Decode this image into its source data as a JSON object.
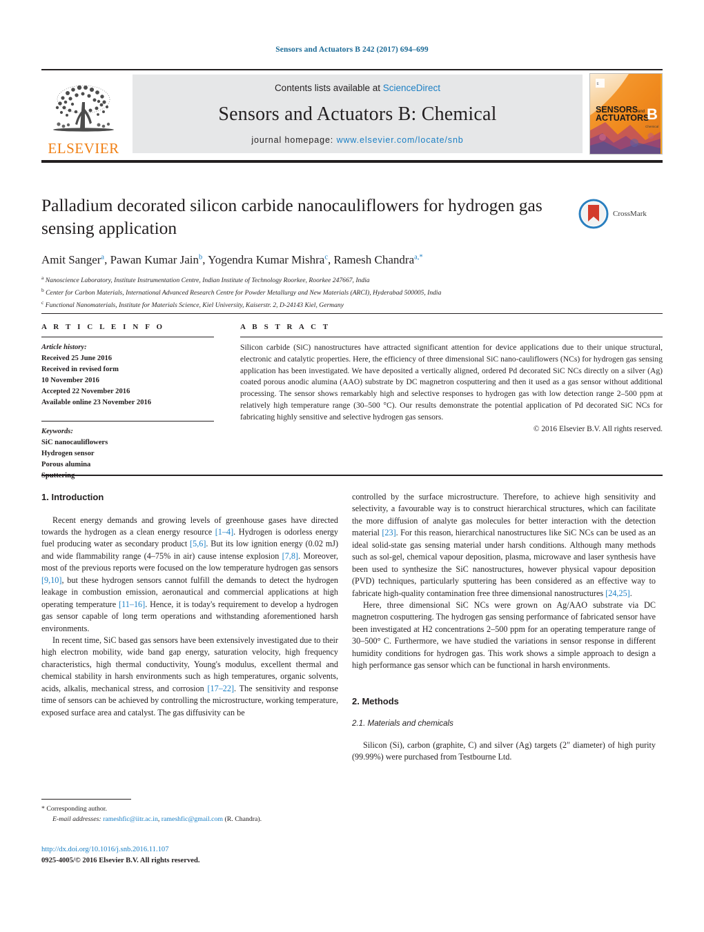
{
  "running_head": "Sensors and Actuators B 242 (2017) 694–699",
  "masthead": {
    "elsevier_wordmark": "ELSEVIER",
    "contents_prefix": "Contents lists available at ",
    "contents_link": "ScienceDirect",
    "journal_title": "Sensors and Actuators B: Chemical",
    "homepage_prefix": "journal homepage: ",
    "homepage_url": "www.elsevier.com/locate/snb",
    "cover_line1": "SENSORS",
    "cover_and": "and",
    "cover_line2": "ACTUATORS",
    "cover_letter": "B",
    "cover_sub": "Chemical"
  },
  "article": {
    "title": "Palladium decorated silicon carbide nanocauliflowers for hydrogen gas sensing application",
    "crossmark_label": "CrossMark",
    "authors": [
      {
        "name": "Amit Sanger",
        "marks": "a"
      },
      {
        "name": "Pawan Kumar Jain",
        "marks": "b"
      },
      {
        "name": "Yogendra Kumar Mishra",
        "marks": "c"
      },
      {
        "name": "Ramesh Chandra",
        "marks": "a,*"
      }
    ],
    "affiliations": [
      {
        "mark": "a",
        "text": "Nanoscience Laboratory, Institute Instrumentation Centre, Indian Institute of Technology Roorkee, Roorkee 247667, India"
      },
      {
        "mark": "b",
        "text": "Center for Carbon Materials, International Advanced Research Centre for Powder Metallurgy and New Materials (ARCI), Hyderabad 500005, India"
      },
      {
        "mark": "c",
        "text": "Functional Nanomaterials, Institute for Materials Science, Kiel University, Kaiserstr. 2, D-24143 Kiel, Germany"
      }
    ]
  },
  "article_info": {
    "heading": "A R T I C L E    I N F O",
    "history_label": "Article history:",
    "history": [
      "Received 25 June 2016",
      "Received in revised form",
      "10 November 2016",
      "Accepted 22 November 2016",
      "Available online 23 November 2016"
    ],
    "keywords_label": "Keywords:",
    "keywords": [
      "SiC nanocauliflowers",
      "Hydrogen sensor",
      "Porous alumina",
      "Sputtering"
    ]
  },
  "abstract": {
    "heading": "A B S T R A C T",
    "text": "Silicon carbide (SiC) nanostructures have attracted significant attention for device applications due to their unique structural, electronic and catalytic properties. Here, the efficiency of three dimensional SiC nano-cauliflowers (NCs) for hydrogen gas sensing application has been investigated. We have deposited a vertically aligned, ordered Pd decorated SiC NCs directly on a silver (Ag) coated porous anodic alumina (AAO) substrate by DC magnetron cosputtering and then it used as a gas sensor without additional processing. The sensor shows remarkably high and selective responses to hydrogen gas with low detection range 2–500 ppm at relatively high temperature range (30–500 °C). Our results demonstrate the potential application of Pd decorated SiC NCs for fabricating highly sensitive and selective hydrogen gas sensors.",
    "copyright": "© 2016 Elsevier B.V. All rights reserved."
  },
  "body": {
    "section1_heading": "1. Introduction",
    "intro_p1_a": "Recent energy demands and growing levels of greenhouse gases have directed towards the hydrogen as a clean energy resource ",
    "intro_ref1": "[1–4]",
    "intro_p1_b": ". Hydrogen is odorless energy fuel producing water as secondary product ",
    "intro_ref2": "[5,6]",
    "intro_p1_c": ". But its low ignition energy (0.02 mJ) and wide flammability range (4–75% in air) cause intense explosion ",
    "intro_ref3": "[7,8]",
    "intro_p1_d": ". Moreover, most of the previous reports were focused on the low temperature hydrogen gas sensors ",
    "intro_ref4": "[9,10]",
    "intro_p1_e": ", but these hydrogen sensors cannot fulfill the demands to detect the hydrogen leakage in combustion emission, aeronautical and commercial applications at high operating temperature ",
    "intro_ref5": "[11–16]",
    "intro_p1_f": ". Hence, it is today's requirement to develop a hydrogen gas sensor capable of long term operations and withstanding aforementioned harsh environments.",
    "intro_p2_a": "In recent time, SiC based gas sensors have been extensively investigated due to their high electron mobility, wide band gap energy, saturation velocity, high frequency characteristics, high thermal conductivity, Young's modulus, excellent thermal and chemical stability in harsh environments such as high temperatures, organic solvents, acids, alkalis, mechanical stress, and corrosion ",
    "intro_ref6": "[17–22]",
    "intro_p2_b": ". The sensitivity and response time of sensors can be achieved by controlling the microstructure, working temperature, exposed surface area and catalyst. The gas diffusivity can be ",
    "intro_p2_c": "controlled by the surface microstructure. Therefore, to achieve high sensitivity and selectivity, a favourable way is to construct hierarchical structures, which can facilitate the more diffusion of analyte gas molecules for better interaction with the detection material ",
    "intro_ref7": "[23]",
    "intro_p2_d": ". For this reason, hierarchical nanostructures like SiC NCs can be used as an ideal solid-state gas sensing material under harsh conditions. Although many methods such as sol-gel, chemical vapour deposition, plasma, microwave and laser synthesis have been used to synthesize the SiC nanostructures, however physical vapour deposition (PVD) techniques, particularly sputtering has been considered as an effective way to fabricate high-quality contamination free three dimensional nanostructures ",
    "intro_ref8": "[24,25]",
    "intro_p2_e": ".",
    "intro_p3": "Here, three dimensional SiC NCs were grown on Ag/AAO substrate via DC magnetron cosputtering. The hydrogen gas sensing performance of fabricated sensor have been investigated at H2 concentrations 2–500 ppm for an operating temperature range of 30–500° C. Furthermore, we have studied the variations in sensor response in different humidity conditions for hydrogen gas. This work shows a simple approach to design a high performance gas sensor which can be functional in harsh environments.",
    "section2_heading": "2. Methods",
    "section21_heading": "2.1. Materials and chemicals",
    "methods_p1": "Silicon (Si), carbon (graphite, C) and silver (Ag) targets (2\" diameter) of high purity (99.99%) were purchased from Testbourne Ltd."
  },
  "footer": {
    "corresponding_marker": "*",
    "corresponding_label": "Corresponding author.",
    "email_label": "E-mail addresses:",
    "email1": "rameshfic@iitr.ac.in",
    "email_sep": ", ",
    "email2": "rameshfic@gmail.com",
    "email_suffix": " (R. Chandra).",
    "doi": "http://dx.doi.org/10.1016/j.snb.2016.11.107",
    "issn_line": "0925-4005/© 2016 Elsevier B.V. All rights reserved."
  },
  "colors": {
    "link": "#1b7fc4",
    "running_head": "#1b6a96",
    "elsevier_orange": "#f07f13",
    "text": "#231f20",
    "masthead_bg": "#e6e7e8"
  }
}
